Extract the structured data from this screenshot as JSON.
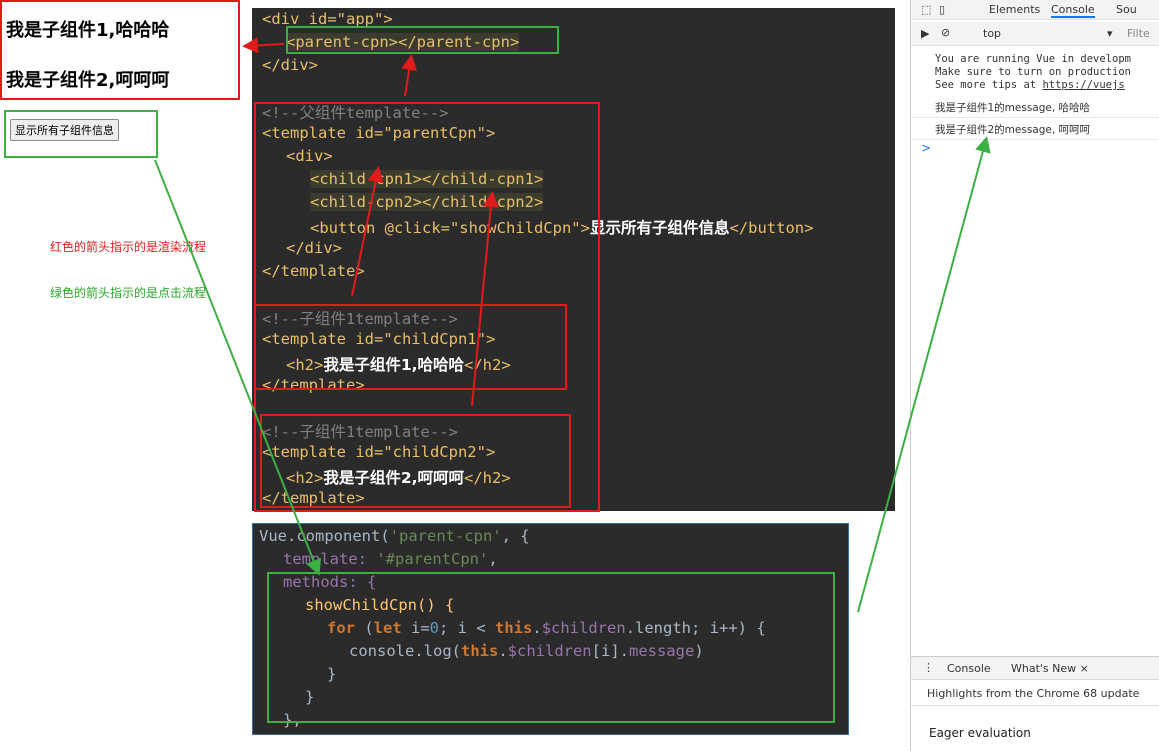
{
  "rendered_page": {
    "child1_heading": "我是子组件1,哈哈哈",
    "child2_heading": "我是子组件2,呵呵呵",
    "button_label": "显示所有子组件信息"
  },
  "annotations": {
    "red_note": "红色的箭头指示的是渲染流程",
    "green_note": "绿色的箭头指示的是点击流程",
    "red_color": "#e01b1b",
    "green_color": "#3cb043"
  },
  "html_code": {
    "div_open": "<div id=\"app\">",
    "parent_cpn": "<parent-cpn></parent-cpn>",
    "div_close": "</div>",
    "comment_parent": "<!--父组件template-->",
    "template_parent": "<template id=\"parentCpn\">",
    "inner_div_open": "<div>",
    "child_cpn1": "<child-cpn1></child-cpn1>",
    "child_cpn2": "<child-cpn2></child-cpn2>",
    "button_line_prefix": "<button @click=\"showChildCpn\">",
    "button_line_text": "显示所有子组件信息",
    "button_line_suffix": "</button>",
    "inner_div_close": "</div>",
    "template_close_1": "</template>",
    "comment_child1": "<!--子组件1template-->",
    "template_child1": "<template id=\"childCpn1\">",
    "h2_child1_open": "<h2>",
    "h2_child1_text": "我是子组件1,哈哈哈",
    "h2_child1_close": "</h2>",
    "template_close_2": "</template>",
    "comment_child2": "<!--子组件1template-->",
    "template_child2": "<template id=\"childCpn2\">",
    "h2_child2_open": "<h2>",
    "h2_child2_text": "我是子组件2,呵呵呵",
    "h2_child2_close": "</h2>",
    "template_close_3": "</template>"
  },
  "js_code": {
    "line1_a": "Vue.component(",
    "line1_b": "'parent-cpn'",
    "line1_c": ", {",
    "line2_a": "template: ",
    "line2_b": "'#parentCpn'",
    "line2_c": ",",
    "line3": "methods: {",
    "line4": "showChildCpn() {",
    "line5_for": "for",
    "line5_let": "let",
    "line5_i0": " i=",
    "line5_zero": "0",
    "line5_cond": "; i < ",
    "line5_this": "this",
    "line5_dot": ".",
    "line5_children": "$children",
    "line5_rest": ".length; i++) {",
    "line6_a": "console.log(",
    "line6_this": "this",
    "line6_dot": ".",
    "line6_children": "$children",
    "line6_b": "[i].",
    "line6_message": "message",
    "line6_c": ")",
    "line7": "}",
    "line8": "}",
    "line9": "},"
  },
  "devtools": {
    "tabs": [
      "Elements",
      "Console",
      "Sou"
    ],
    "active_tab": "Console",
    "context": "top",
    "filter_placeholder": "Filte",
    "vue_warning_1": "You are running Vue in developm",
    "vue_warning_2": "Make sure to turn on production",
    "vue_warning_3_a": "See more tips at ",
    "vue_warning_3_link": "https://vuejs",
    "log1": "我是子组件1的message, 哈哈哈",
    "log2": "我是子组件2的message, 呵呵呵",
    "prompt": ">",
    "drawer_tab_console": "Console",
    "drawer_tab_whatsnew": "What's New ×",
    "drawer_highlight": "Highlights from the Chrome 68 update",
    "drawer_feature": "Eager evaluation"
  }
}
